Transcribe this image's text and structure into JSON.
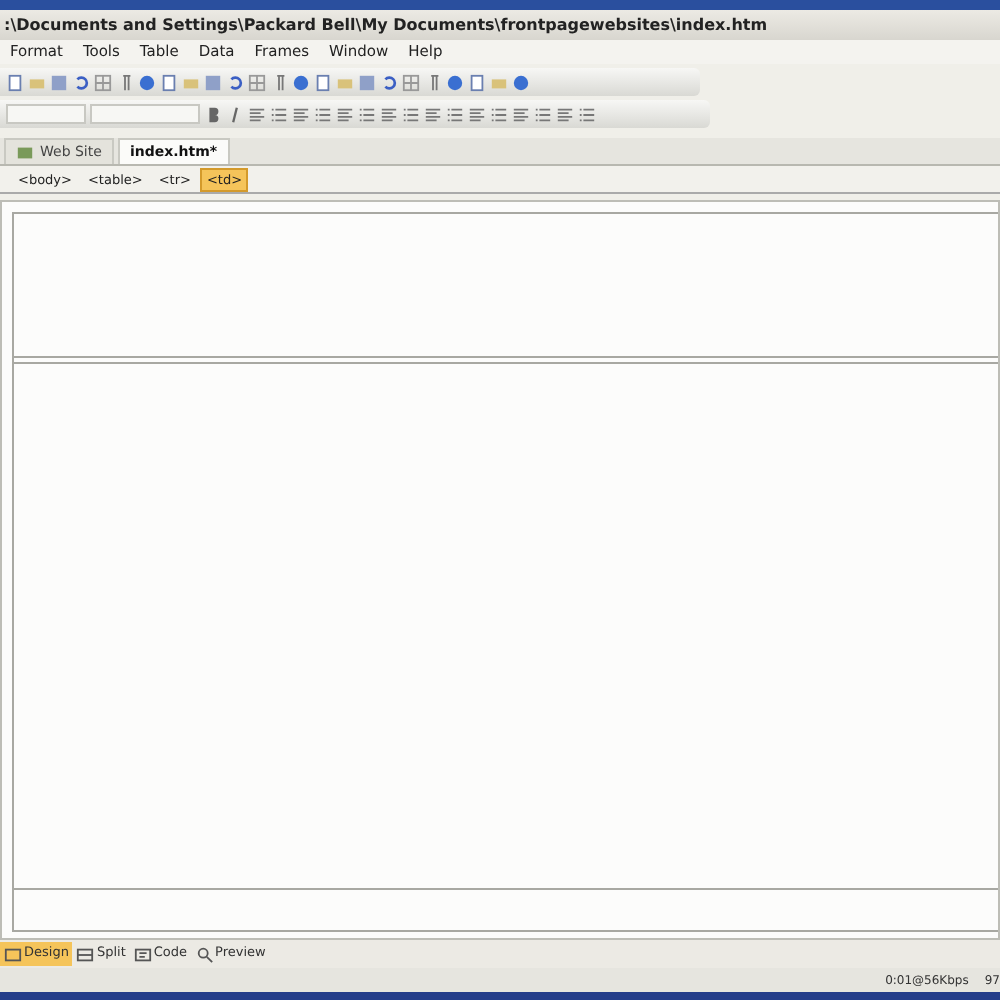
{
  "window": {
    "title": ":\\Documents and Settings\\Packard Bell\\My Documents\\frontpagewebsites\\index.htm"
  },
  "menu": [
    "Format",
    "Tools",
    "Table",
    "Data",
    "Frames",
    "Window",
    "Help"
  ],
  "doc_tabs": [
    {
      "label": "Web Site",
      "selected": false
    },
    {
      "label": "index.htm*",
      "selected": true
    }
  ],
  "tag_path": [
    {
      "label": "<body>",
      "selected": false
    },
    {
      "label": "<table>",
      "selected": false
    },
    {
      "label": "<tr>",
      "selected": false
    },
    {
      "label": "<td>",
      "selected": true
    }
  ],
  "view_tabs": [
    {
      "label": "Design",
      "selected": true
    },
    {
      "label": "Split",
      "selected": false
    },
    {
      "label": "Code",
      "selected": false
    },
    {
      "label": "Preview",
      "selected": false
    }
  ],
  "status_bar": {
    "download_time": "0:01@56Kbps",
    "cut_text": "97"
  }
}
